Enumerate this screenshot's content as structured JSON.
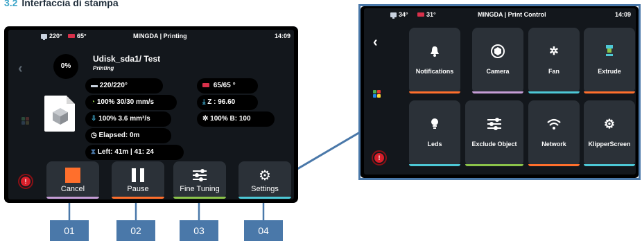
{
  "heading": {
    "number": "3.2",
    "title": "Interfaccia di stampa"
  },
  "left_screen": {
    "status": {
      "nozzle_temp": "220°",
      "bed_temp": "65°",
      "title": "MINGDA | Printing",
      "time": "14:09"
    },
    "progress": "0%",
    "file_name": "Udisk_sda1/ Test",
    "file_status": "Printing",
    "info": {
      "extruder": "220/220°",
      "speed": "100% 30/30 mm/s",
      "flow": "100%  3.6 mm³/s",
      "elapsed": "Elapsed: 0m",
      "left": "Left:  41m | 41: 24",
      "bed": "65/65 °",
      "z": "Z : 96.60",
      "fan": "100% B: 100"
    },
    "buttons": [
      {
        "label": "Cancel",
        "color": "#ff6f2c"
      },
      {
        "label": "Pause",
        "color": "#ff6f2c"
      },
      {
        "label": "Fine Tuning",
        "color": "#8bc34a"
      },
      {
        "label": "Settings",
        "color": "#4dc8d6"
      }
    ],
    "alert_icon": "!"
  },
  "right_screen": {
    "status": {
      "nozzle_temp": "34°",
      "bed_temp": "31°",
      "title": "MINGDA | Print Control",
      "time": "14:09"
    },
    "alert_icon": "!",
    "tiles": [
      {
        "label": "Notifications",
        "icon": "bell-icon",
        "bar_color": "#ff6f2c"
      },
      {
        "label": "Camera",
        "icon": "camera-icon",
        "bar_color": "#c59dd6"
      },
      {
        "label": "Fan",
        "icon": "fan-icon",
        "bar_color": "#4dc8d6"
      },
      {
        "label": "Extrude",
        "icon": "extruder-icon",
        "bar_color": "#ff6f2c"
      },
      {
        "label": "Leds",
        "icon": "bulb-icon",
        "bar_color": "#4dc8d6"
      },
      {
        "label": "Exclude Object",
        "icon": "sliders-icon",
        "bar_color": "#8bc34a"
      },
      {
        "label": "Network",
        "icon": "wifi-icon",
        "bar_color": "#ff6f2c"
      },
      {
        "label": "KlipperScreen",
        "icon": "gears-icon",
        "bar_color": "#4dc8d6"
      }
    ]
  },
  "callouts": [
    "01",
    "02",
    "03",
    "04"
  ]
}
